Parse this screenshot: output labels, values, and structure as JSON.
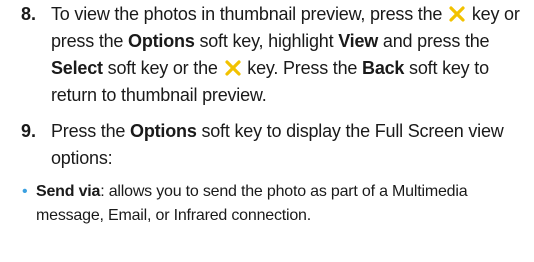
{
  "step8": {
    "number": "8.",
    "t1": "To view the photos in thumbnail preview, press the ",
    "nav_icon": "nav-center-key-icon",
    "t2": " key or press the ",
    "options": "Options",
    "t3": " soft key, highlight ",
    "view": "View",
    "t4": " and press the ",
    "select": "Select",
    "t5": " soft key or the ",
    "t6": " key. Press the ",
    "back": "Back",
    "t7": " soft key to return to thumbnail preview."
  },
  "step9": {
    "number": "9.",
    "t1": "Press the ",
    "options": "Options",
    "t2": " soft key to display the Full Screen view options:"
  },
  "bullet1": {
    "marker": "•",
    "title": "Send via",
    "text": ": allows you to send the photo as part of a Multimedia message, Email, or Infrared connection."
  },
  "colors": {
    "bullet": "#3ba0e0",
    "nav_icon": "#f2c200",
    "text": "#1a1a1a"
  }
}
